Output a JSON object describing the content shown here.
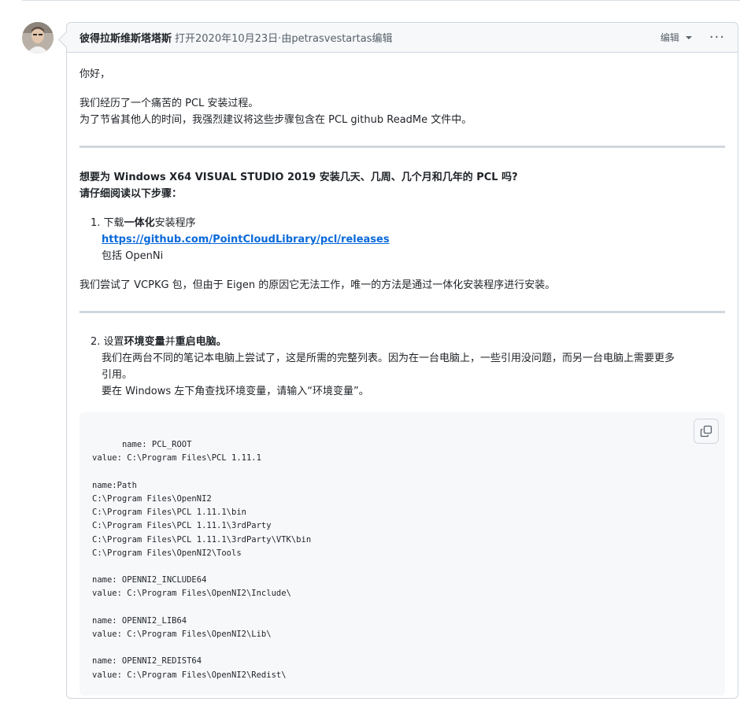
{
  "comment": {
    "author": "彼得拉斯维斯塔塔斯",
    "opened": "打开2020年10月23日·由petrasvestartas编辑",
    "edit_label": "编辑",
    "more_icon": "kebab-horizontal-icon"
  },
  "body": {
    "greeting": "你好，",
    "intro_line1": "我们经历了一个痛苦的 PCL 安装过程。",
    "intro_line2": "为了节省其他人的时间，我强烈建议将这些步骤包含在 PCL github ReadMe 文件中。",
    "heading1": "想要为 Windows X64 VISUAL STUDIO 2019 安装几天、几周、几个月和几年的 PCL 吗?",
    "heading2": "请仔细阅读以下步骤：",
    "step1": {
      "number": "1.",
      "prefix": "下载",
      "bold": "一体化",
      "suffix": "安装程序",
      "link": "https://github.com/PointCloudLibrary/pcl/releases",
      "note": "包括 OpenNi"
    },
    "vcpkg_note": "我们尝试了 VCPKG 包，但由于 Eigen 的原因它无法工作，唯一的方法是通过一体化安装程序进行安装。",
    "step2": {
      "number": "2.",
      "prefix": "设置",
      "bold1": "环境变量",
      "mid": "并",
      "bold2": "重启电脑。",
      "line1": "我们在两台不同的笔记本电脑上尝试了，这是所需的完整列表。因为在一台电脑上，一些引用没问题，而另一台电脑上需要更多",
      "line2": "引用。",
      "line3": "要在 Windows 左下角查找环境变量，请输入“环境变量”。"
    },
    "code": "name: PCL_ROOT\nvalue: C:\\Program Files\\PCL 1.11.1\n\nname:Path\nC:\\Program Files\\OpenNI2\nC:\\Program Files\\PCL 1.11.1\\bin\nC:\\Program Files\\PCL 1.11.1\\3rdParty\nC:\\Program Files\\PCL 1.11.1\\3rdParty\\VTK\\bin\nC:\\Program Files\\OpenNI2\\Tools\n\nname: OPENNI2_INCLUDE64\nvalue: C:\\Program Files\\OpenNI2\\Include\\\n\nname: OPENNI2_LIB64\nvalue: C:\\Program Files\\OpenNI2\\Lib\\\n\nname: OPENNI2_REDIST64\nvalue: C:\\Program Files\\OpenNI2\\Redist\\",
    "copy_icon": "copy-icon"
  }
}
